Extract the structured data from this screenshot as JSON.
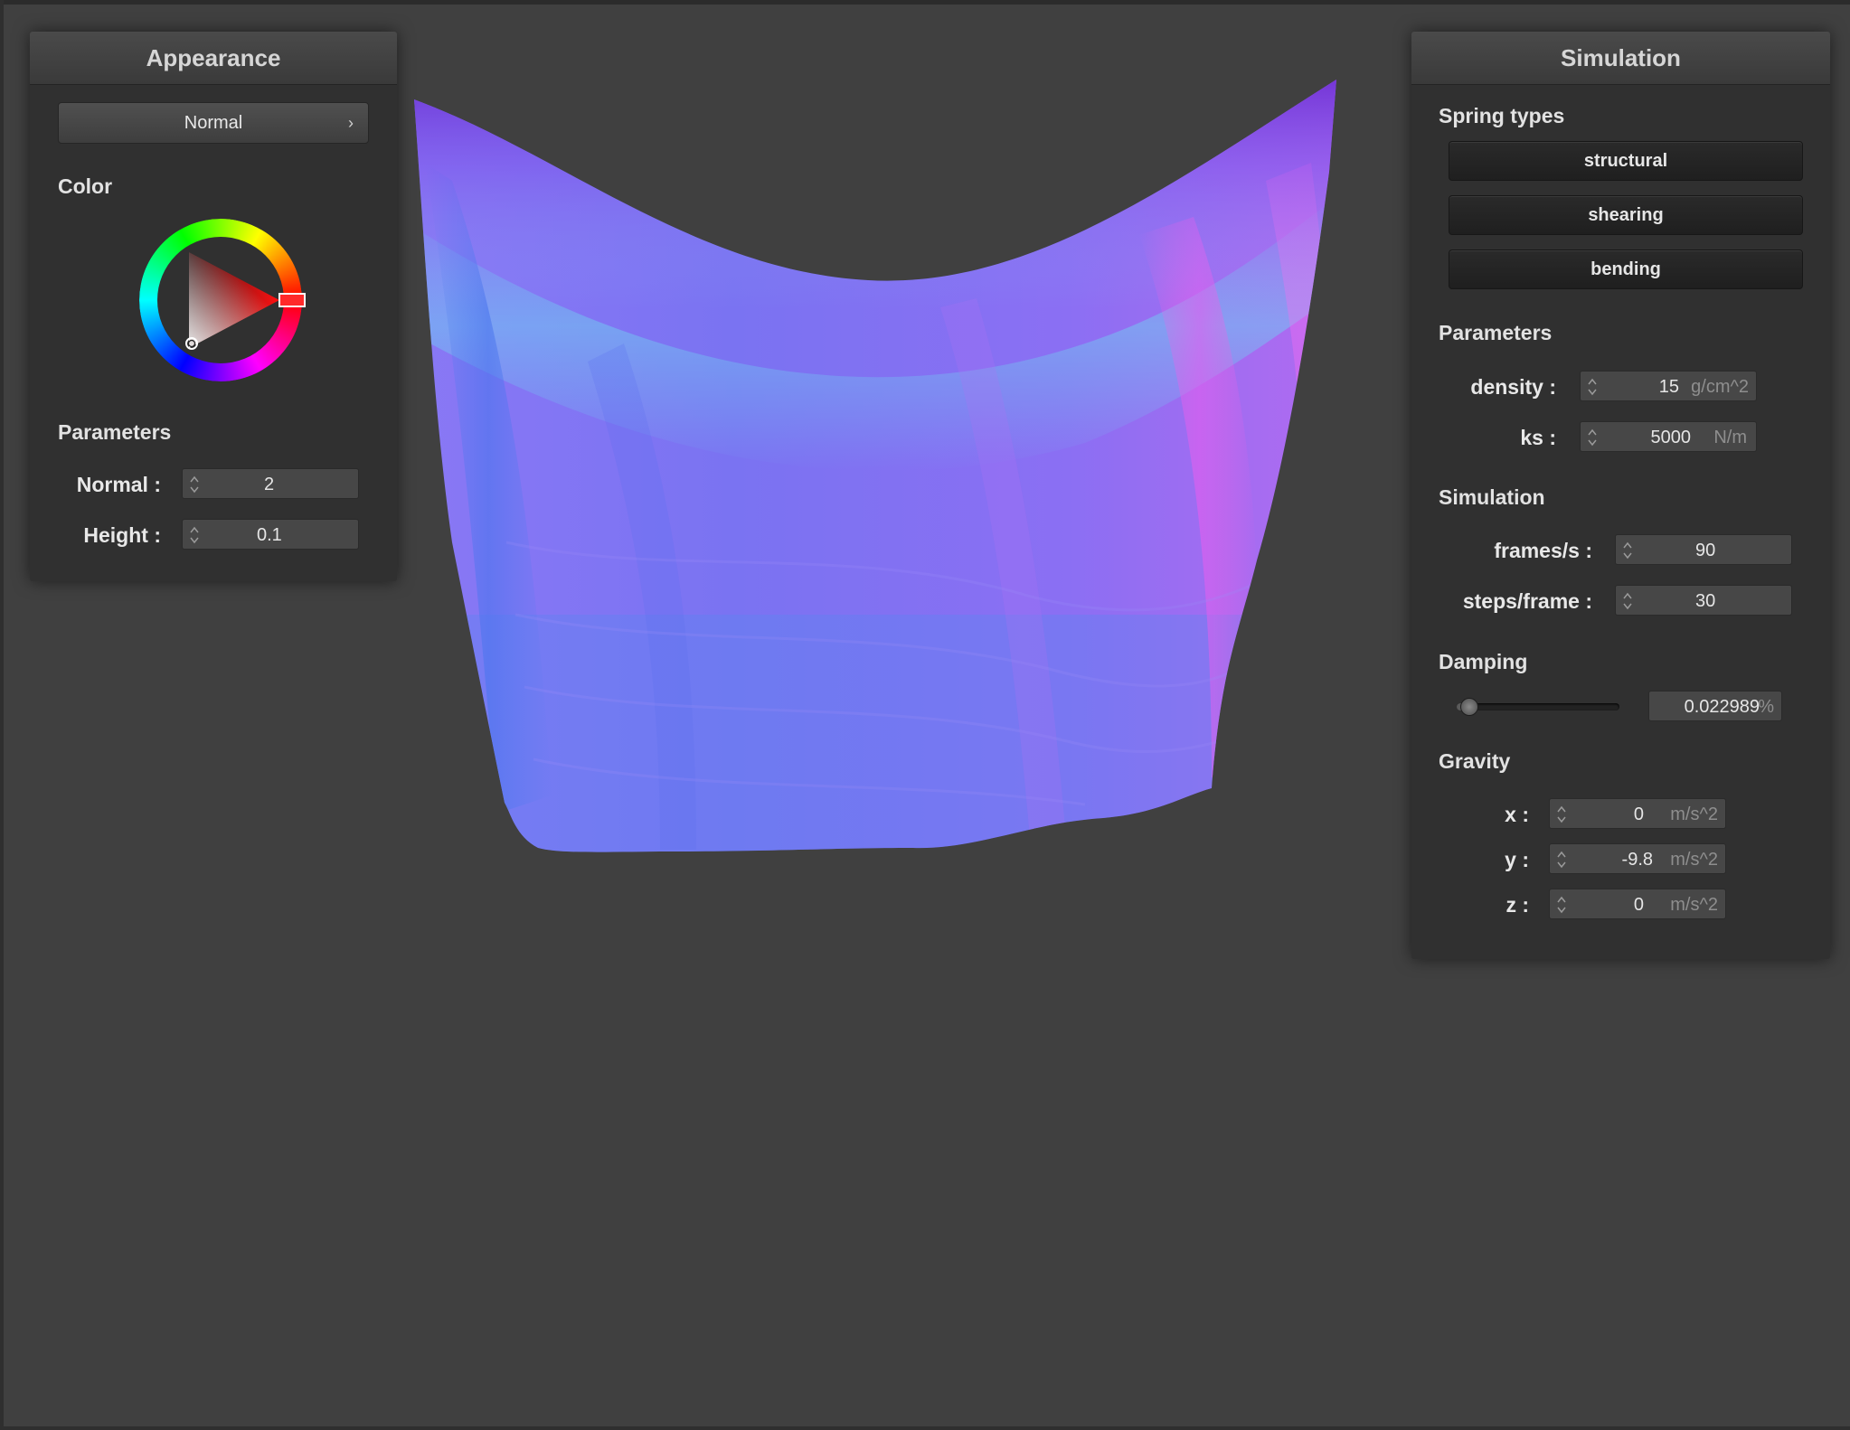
{
  "appearance": {
    "title": "Appearance",
    "shader_select": {
      "value": "Normal",
      "chevron": "chevron-right-icon"
    },
    "color_label": "Color",
    "color_picker": {
      "icon": "color-wheel-icon",
      "selected_hue": "#ff0000"
    },
    "parameters_label": "Parameters",
    "normal": {
      "label": "Normal :",
      "value": "2"
    },
    "height": {
      "label": "Height :",
      "value": "0.1"
    }
  },
  "simulation": {
    "title": "Simulation",
    "spring_types_label": "Spring types",
    "spring_types": [
      "structural",
      "shearing",
      "bending"
    ],
    "parameters_label": "Parameters",
    "density": {
      "label": "density :",
      "value": "15",
      "unit": "g/cm^2"
    },
    "ks": {
      "label": "ks :",
      "value": "5000",
      "unit": "N/m"
    },
    "simulation_label": "Simulation",
    "frames": {
      "label": "frames/s :",
      "value": "90"
    },
    "steps": {
      "label": "steps/frame :",
      "value": "30"
    },
    "damping_label": "Damping",
    "damping": {
      "value": "0.022989",
      "unit": "%",
      "fraction": 0.023
    },
    "gravity_label": "Gravity",
    "gx": {
      "label": "x :",
      "value": "0",
      "unit": "m/s^2"
    },
    "gy": {
      "label": "y :",
      "value": "-9.8",
      "unit": "m/s^2"
    },
    "gz": {
      "label": "z :",
      "value": "0",
      "unit": "m/s^2"
    }
  },
  "viewport": {
    "object": "cloth-mesh",
    "shading": "normal-map"
  }
}
